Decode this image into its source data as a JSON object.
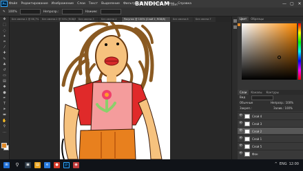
{
  "app": {
    "logo_text": "Ps"
  },
  "menu": [
    "Файл",
    "Редактирование",
    "Изображение",
    "Слои",
    "Текст",
    "Выделение",
    "Фильтр",
    "3D",
    "Просмотр",
    "Окно",
    "Справка"
  ],
  "recording_overlay": {
    "brand": "BANDICAM",
    "suffix": ".com"
  },
  "window_controls": {
    "minimize": "—",
    "maximize": "▢",
    "close": "✕"
  },
  "options": {
    "zoom_label": "100%",
    "opacity_label": "Непрозр.:",
    "flow_label": "Нажим:"
  },
  "tabs": [
    "Без имени-1 @ 66,7% (RGB/8)",
    "Без имени-2 @ 50% (RGB/8)",
    "Без имени-3",
    "Без имени-4",
    "Рисунок @ 100% (Слой 2, RGB/8)",
    "Без имени-6",
    "Без имени-7"
  ],
  "active_tab_index": 4,
  "color_panel": {
    "tabs": [
      "Цвет",
      "Образцы"
    ],
    "foreground": "#e08a2a",
    "background": "#ffffff"
  },
  "layers_panel": {
    "tabs": [
      "Слои",
      "Каналы",
      "Контуры"
    ],
    "kind_label": "Вид",
    "blend_mode": "Обычные",
    "opacity_label": "Непрозр.: 100%",
    "lock_label": "Закреп.:",
    "fill_label": "Залив.: 100%",
    "layers": [
      {
        "name": "Слой 4",
        "visible": true,
        "selected": false
      },
      {
        "name": "Слой 3",
        "visible": true,
        "selected": false
      },
      {
        "name": "Слой 2",
        "visible": true,
        "selected": true
      },
      {
        "name": "Слой 1",
        "visible": true,
        "selected": false
      },
      {
        "name": "Слой 5",
        "visible": true,
        "selected": false
      },
      {
        "name": "Фон",
        "visible": true,
        "selected": false
      }
    ]
  },
  "taskbar": {
    "tray": [
      "^",
      "ENG",
      "12:00"
    ]
  }
}
